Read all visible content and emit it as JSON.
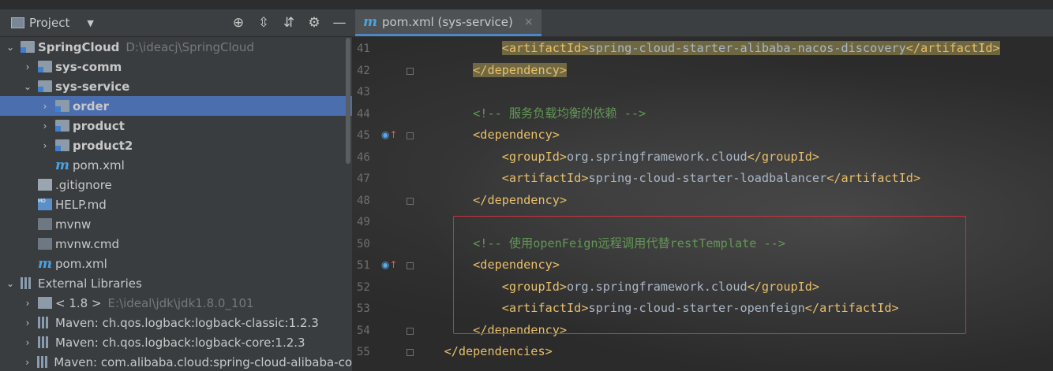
{
  "project_panel": {
    "title": "Project",
    "tree": [
      {
        "label": "SpringCloud",
        "path": "D:\\ideacj\\SpringCloud",
        "depth": 0,
        "expanded": true,
        "icon": "module-folder-icon",
        "bold": true
      },
      {
        "label": "sys-comm",
        "depth": 1,
        "expanded": false,
        "icon": "module-folder-icon",
        "bold": true
      },
      {
        "label": "sys-service",
        "depth": 1,
        "expanded": true,
        "icon": "module-folder-icon",
        "bold": true
      },
      {
        "label": "order",
        "depth": 2,
        "expanded": false,
        "icon": "module-folder-icon",
        "bold": true,
        "selected": true
      },
      {
        "label": "product",
        "depth": 2,
        "expanded": false,
        "icon": "module-folder-icon",
        "bold": true
      },
      {
        "label": "product2",
        "depth": 2,
        "expanded": false,
        "icon": "module-folder-icon",
        "bold": true
      },
      {
        "label": "pom.xml",
        "depth": 2,
        "icon": "maven-file-icon"
      },
      {
        "label": ".gitignore",
        "depth": 1,
        "icon": "gitignore-file-icon"
      },
      {
        "label": "HELP.md",
        "depth": 1,
        "icon": "markdown-file-icon"
      },
      {
        "label": "mvnw",
        "depth": 1,
        "icon": "shell-file-icon"
      },
      {
        "label": "mvnw.cmd",
        "depth": 1,
        "icon": "shell-file-icon"
      },
      {
        "label": "pom.xml",
        "depth": 1,
        "icon": "maven-file-icon"
      },
      {
        "label": "External Libraries",
        "depth": 0,
        "expanded": true,
        "icon": "libraries-icon"
      },
      {
        "label": "< 1.8 >",
        "path": "E:\\ideal\\jdk\\jdk1.8.0_101",
        "depth": 1,
        "expanded": false,
        "icon": "jdk-folder-icon"
      },
      {
        "label": "Maven: ch.qos.logback:logback-classic:1.2.3",
        "depth": 1,
        "expanded": false,
        "icon": "library-jar-icon"
      },
      {
        "label": "Maven: ch.qos.logback:logback-core:1.2.3",
        "depth": 1,
        "expanded": false,
        "icon": "library-jar-icon"
      },
      {
        "label": "Maven: com.alibaba.cloud:spring-cloud-alibaba-co",
        "depth": 1,
        "expanded": false,
        "icon": "library-jar-icon"
      }
    ]
  },
  "editor": {
    "tab": {
      "label": "pom.xml (sys-service)",
      "icon": "maven-file-icon",
      "close": "×"
    },
    "lines": [
      {
        "n": "41",
        "indent": 12,
        "parts": [
          {
            "t": "tag",
            "v": "<artifactId>"
          },
          {
            "t": "txt",
            "v": "spring-cloud-starter-alibaba-nacos-discovery"
          },
          {
            "t": "tag",
            "v": "</artifactId>"
          }
        ],
        "highlight": true
      },
      {
        "n": "42",
        "indent": 8,
        "parts": [
          {
            "t": "tag",
            "v": "</dependency>"
          }
        ],
        "highlight": true,
        "fold": true
      },
      {
        "n": "43",
        "indent": 0,
        "parts": []
      },
      {
        "n": "44",
        "indent": 8,
        "parts": [
          {
            "t": "cmt",
            "v": "<!-- 服务负载均衡的依赖 -->"
          }
        ]
      },
      {
        "n": "45",
        "indent": 8,
        "parts": [
          {
            "t": "tag",
            "v": "<dependency>"
          }
        ],
        "gutter_icon": "override-up-icon",
        "fold": true
      },
      {
        "n": "46",
        "indent": 12,
        "parts": [
          {
            "t": "tag",
            "v": "<groupId>"
          },
          {
            "t": "txt",
            "v": "org.springframework.cloud"
          },
          {
            "t": "tag",
            "v": "</groupId>"
          }
        ]
      },
      {
        "n": "47",
        "indent": 12,
        "parts": [
          {
            "t": "tag",
            "v": "<artifactId>"
          },
          {
            "t": "txt",
            "v": "spring-cloud-starter-loadbalancer"
          },
          {
            "t": "tag",
            "v": "</artifactId>"
          }
        ]
      },
      {
        "n": "48",
        "indent": 8,
        "parts": [
          {
            "t": "tag",
            "v": "</dependency>"
          }
        ],
        "fold": true
      },
      {
        "n": "49",
        "indent": 0,
        "parts": []
      },
      {
        "n": "50",
        "indent": 8,
        "parts": [
          {
            "t": "cmt",
            "v": "<!-- 使用openFeign远程调用代替restTemplate -->"
          }
        ]
      },
      {
        "n": "51",
        "indent": 8,
        "parts": [
          {
            "t": "tag",
            "v": "<dependency>"
          }
        ],
        "gutter_icon": "override-up-icon",
        "fold": true
      },
      {
        "n": "52",
        "indent": 12,
        "parts": [
          {
            "t": "tag",
            "v": "<groupId>"
          },
          {
            "t": "txt",
            "v": "org.springframework.cloud"
          },
          {
            "t": "tag",
            "v": "</groupId>"
          }
        ]
      },
      {
        "n": "53",
        "indent": 12,
        "parts": [
          {
            "t": "tag",
            "v": "<artifactId>"
          },
          {
            "t": "txt",
            "v": "spring-cloud-starter-openfeign"
          },
          {
            "t": "tag",
            "v": "</artifactId>"
          }
        ]
      },
      {
        "n": "54",
        "indent": 8,
        "parts": [
          {
            "t": "tag",
            "v": "</dependency>"
          }
        ],
        "fold": true
      },
      {
        "n": "55",
        "indent": 4,
        "parts": [
          {
            "t": "tag",
            "v": "</dependencies>"
          }
        ],
        "fold": true
      }
    ]
  },
  "colors": {
    "selection": "#4b6eaf",
    "tag": "#e8bf6a",
    "comment": "#629755",
    "text": "#a9b7c6",
    "redbox": "#d0303c"
  }
}
